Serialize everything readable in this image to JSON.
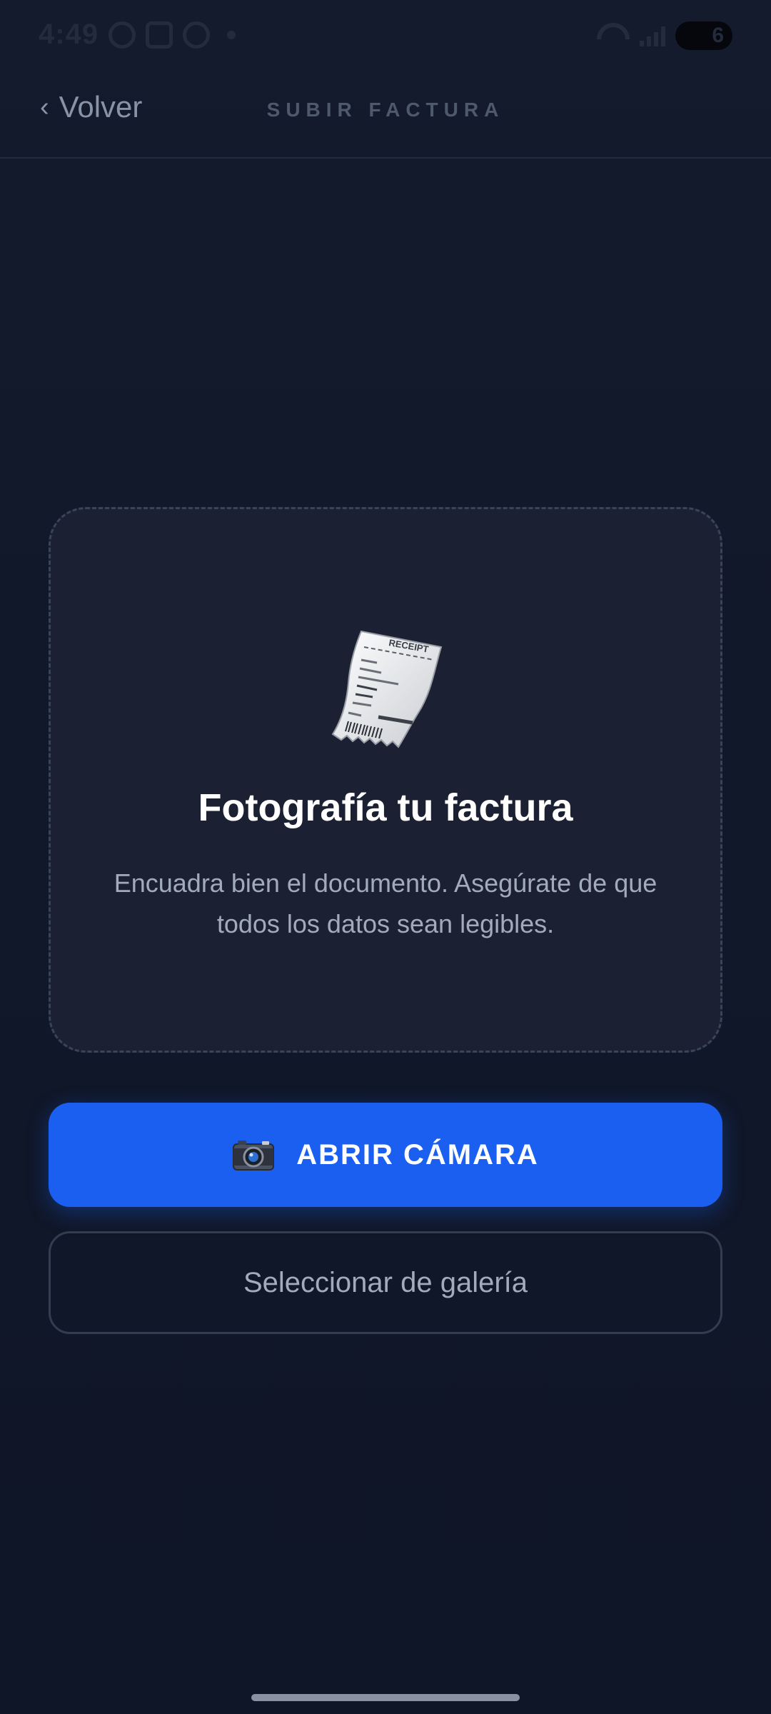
{
  "status_bar": {
    "time": "4:49",
    "battery": "6"
  },
  "header": {
    "back_label": "Volver",
    "title": "SUBIR FACTURA"
  },
  "upload_card": {
    "icon": "receipt-icon",
    "title": "Fotografía tu factura",
    "subtitle": "Encuadra bien el documento. Asegúrate de que todos los datos sean legibles."
  },
  "actions": {
    "camera_label": "ABRIR CÁMARA",
    "camera_icon": "camera-icon",
    "gallery_label": "Seleccionar de galería"
  },
  "colors": {
    "background": "#111829",
    "card": "#1b2133",
    "primary": "#1a5ff0",
    "text_primary": "#ffffff",
    "text_secondary": "#a2abbb"
  }
}
